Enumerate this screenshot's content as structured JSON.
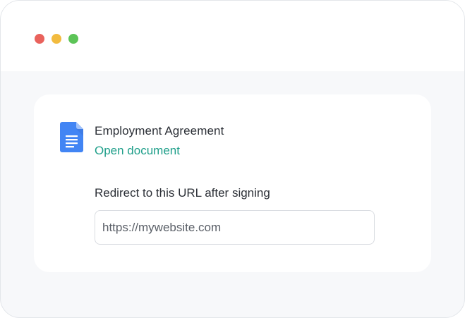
{
  "window": {
    "controls": [
      {
        "name": "close",
        "color": "#e9625c"
      },
      {
        "name": "minimize",
        "color": "#f2bb3f"
      },
      {
        "name": "maximize",
        "color": "#5cc457"
      }
    ]
  },
  "document": {
    "icon": "google-docs-icon",
    "title": "Employment Agreement",
    "open_link": "Open document"
  },
  "redirect": {
    "label": "Redirect to this URL after signing",
    "value": "https://mywebsite.com"
  },
  "colors": {
    "accent": "#1f9f8a",
    "doc_icon_blue": "#4285f4"
  }
}
